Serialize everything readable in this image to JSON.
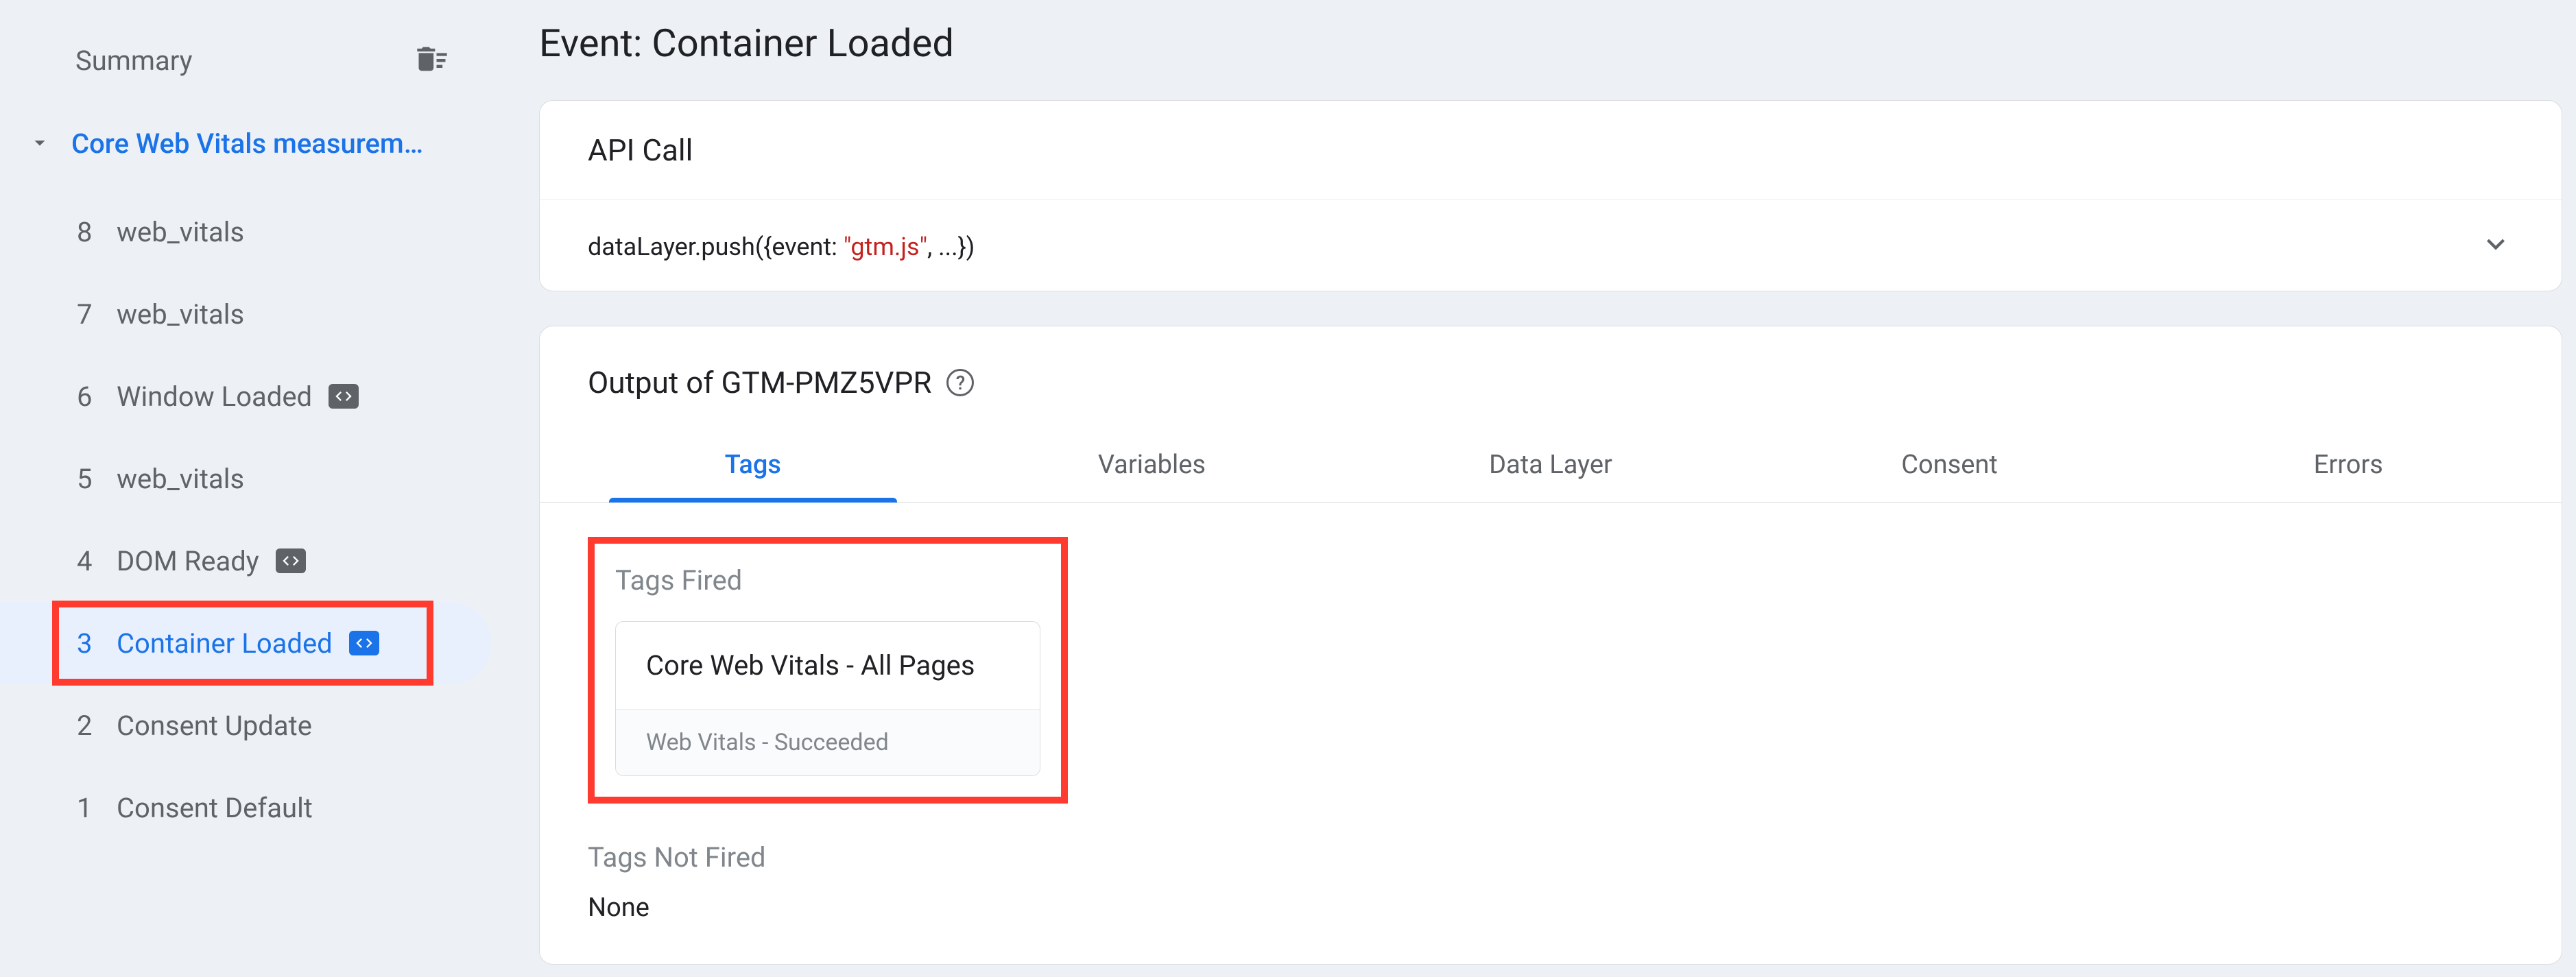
{
  "sidebar": {
    "summary": "Summary",
    "root_label": "Core Web Vitals measurem…",
    "events": [
      {
        "num": "8",
        "label": "web_vitals",
        "badge": false,
        "selected": false
      },
      {
        "num": "7",
        "label": "web_vitals",
        "badge": false,
        "selected": false
      },
      {
        "num": "6",
        "label": "Window Loaded",
        "badge": true,
        "selected": false
      },
      {
        "num": "5",
        "label": "web_vitals",
        "badge": false,
        "selected": false
      },
      {
        "num": "4",
        "label": "DOM Ready",
        "badge": true,
        "selected": false
      },
      {
        "num": "3",
        "label": "Container Loaded",
        "badge": true,
        "selected": true
      },
      {
        "num": "2",
        "label": "Consent Update",
        "badge": false,
        "selected": false
      },
      {
        "num": "1",
        "label": "Consent Default",
        "badge": false,
        "selected": false
      }
    ]
  },
  "main": {
    "title": "Event: Container Loaded",
    "api_card": {
      "header": "API Call",
      "prefix": "dataLayer.push({event: ",
      "string": "\"gtm.js\"",
      "suffix": ", ...})"
    },
    "output": {
      "title": "Output of GTM-PMZ5VPR",
      "tabs": [
        {
          "label": "Tags",
          "active": true
        },
        {
          "label": "Variables",
          "active": false
        },
        {
          "label": "Data Layer",
          "active": false
        },
        {
          "label": "Consent",
          "active": false
        },
        {
          "label": "Errors",
          "active": false
        }
      ],
      "fired_label": "Tags Fired",
      "fired_tag": {
        "title": "Core Web Vitals - All Pages",
        "subtitle": "Web Vitals - Succeeded"
      },
      "not_fired_label": "Tags Not Fired",
      "none": "None"
    }
  }
}
